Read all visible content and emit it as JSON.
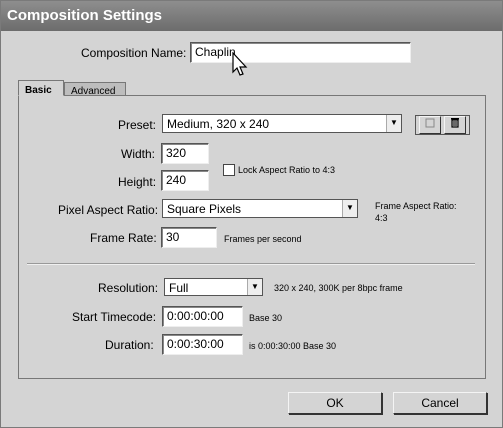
{
  "window": {
    "title": "Composition Settings"
  },
  "comp_name": {
    "label": "Composition Name:",
    "value": "Chaplin"
  },
  "tabs": [
    {
      "label": "Basic"
    },
    {
      "label": "Advanced"
    }
  ],
  "basic": {
    "preset": {
      "label": "Preset:",
      "value": "Medium, 320 x 240"
    },
    "width": {
      "label": "Width:",
      "value": "320"
    },
    "height": {
      "label": "Height:",
      "value": "240"
    },
    "lock_aspect": {
      "label": "Lock Aspect Ratio to 4:3",
      "checked": false
    },
    "pixel_aspect": {
      "label": "Pixel Aspect Ratio:",
      "value": "Square Pixels"
    },
    "frame_aspect": {
      "label": "Frame Aspect Ratio:",
      "value": "4:3"
    },
    "frame_rate": {
      "label": "Frame Rate:",
      "value": "30",
      "unit": "Frames per second"
    },
    "resolution": {
      "label": "Resolution:",
      "value": "Full",
      "info": "320 x 240, 300K per 8bpc frame"
    },
    "start_timecode": {
      "label": "Start Timecode:",
      "value": "0:00:00:00",
      "base": "Base 30"
    },
    "duration": {
      "label": "Duration:",
      "value": "0:00:30:00",
      "info": "is 0:00:30:00  Base 30"
    }
  },
  "buttons": {
    "ok": "OK",
    "cancel": "Cancel"
  },
  "icons": {
    "save_preset": "save-preset-icon",
    "delete_preset": "trash-icon"
  }
}
